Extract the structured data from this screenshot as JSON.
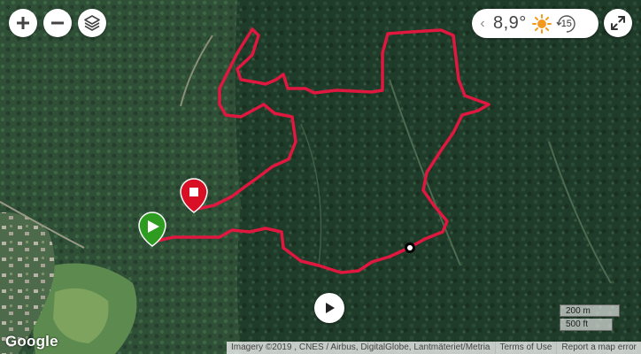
{
  "map": {
    "route_color": "#e0173f",
    "start_marker": {
      "icon": "play-triangle",
      "color": "#2e9c21"
    },
    "finish_marker": {
      "icon": "stop-square",
      "color": "#d90f26"
    }
  },
  "controls": {
    "zoom_in": {
      "icon": "plus-icon"
    },
    "zoom_out": {
      "icon": "minus-icon"
    },
    "layers": {
      "icon": "layers-icon"
    },
    "fullscreen": {
      "icon": "expand-arrows-icon"
    }
  },
  "weather": {
    "prev_arrow": "‹",
    "temperature": "8,9°",
    "icon": "sun-icon",
    "hour": "15"
  },
  "scale": {
    "metric": "200 m",
    "imperial": "500 ft"
  },
  "footer": {
    "logo": "Google",
    "imagery": "Imagery ©2019 , CNES / Airbus, DigitalGlobe, Lantmäteriet/Metria",
    "terms": "Terms of Use",
    "report": "Report a map error"
  }
}
